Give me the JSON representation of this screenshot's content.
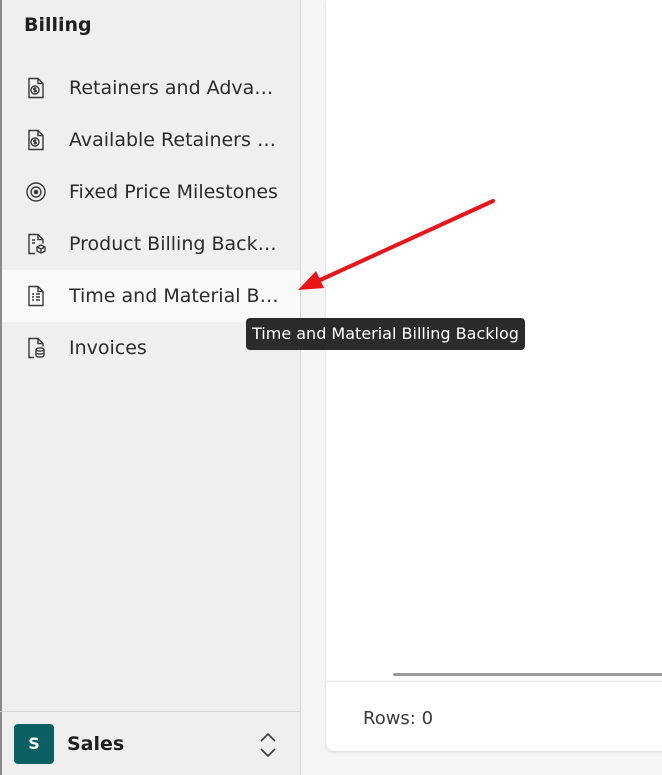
{
  "sidebar": {
    "section_title": "Billing",
    "items": [
      {
        "label": "Retainers and Advances",
        "icon": "money-document-icon"
      },
      {
        "label": "Available Retainers and Advances",
        "icon": "money-document-icon"
      },
      {
        "label": "Fixed Price Milestones",
        "icon": "target-icon"
      },
      {
        "label": "Product Billing Backlog",
        "icon": "document-box-icon"
      },
      {
        "label": "Time and Material Billing Backlog",
        "icon": "document-lines-icon"
      },
      {
        "label": "Invoices",
        "icon": "document-coins-icon"
      }
    ],
    "active_index": 4,
    "footer": {
      "badge": "S",
      "area_name": "Sales",
      "badge_color": "#0c5f62"
    }
  },
  "main": {
    "rows_label": "Rows: 0"
  },
  "tooltip": {
    "text": "Time and Material Billing Backlog"
  },
  "annotation": {
    "arrow_color": "#e8141a"
  }
}
